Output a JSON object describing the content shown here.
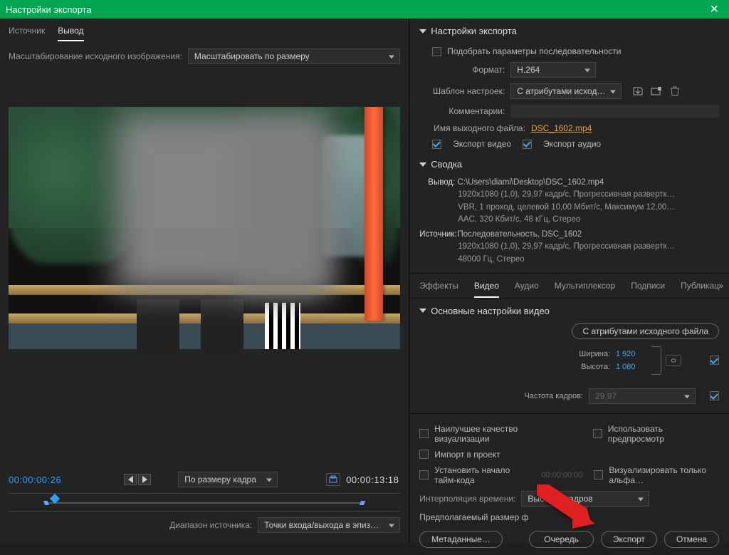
{
  "window": {
    "title": "Настройки экспорта",
    "close": "✕"
  },
  "left": {
    "tabs": {
      "source": "Источник",
      "output": "Вывод"
    },
    "scale_label": "Масштабирование исходного изображения:",
    "scale_value": "Масштабировать по размеру",
    "tc_in": "00:00:00:26",
    "tc_out": "00:00:13:18",
    "fit_label": "По размеру кадра",
    "range_label": "Диапазон источника:",
    "range_value": "Точки входа/выхода в эпиз…"
  },
  "export": {
    "header": "Настройки экспорта",
    "match_seq": "Подобрать параметры последовательности",
    "format_label": "Формат:",
    "format_value": "H.264",
    "preset_label": "Шаблон настроек:",
    "preset_value": "С атрибутами исход…",
    "comments_label": "Комментарии:",
    "outname_label": "Имя выходного файла:",
    "outname_value": "DSC_1602.mp4",
    "export_video": "Экспорт видео",
    "export_audio": "Экспорт аудио"
  },
  "summary": {
    "header": "Сводка",
    "out_label": "Вывод:",
    "out_line1": "C:\\Users\\diami\\Desktop\\DSC_1602.mp4",
    "out_line2": "1920x1080 (1,0), 29,97 кадр/с, Прогрессивная развертк…",
    "out_line3": "VBR, 1 проход, целевой 10,00 Мбит/с, Максимум 12,00…",
    "out_line4": "AAC, 320 Кбит/с, 48 кГц, Стерео",
    "src_label": "Источник:",
    "src_line1": "Последовательность, DSC_1602",
    "src_line2": "1920x1080 (1,0), 29,97 кадр/с, Прогрессивная развертк…",
    "src_line3": "48000 Гц, Стерео"
  },
  "rtabs": {
    "effects": "Эффекты",
    "video": "Видео",
    "audio": "Аудио",
    "mux": "Мультиплексор",
    "captions": "Подписи",
    "publish": "Публикац"
  },
  "video": {
    "header": "Основные настройки видео",
    "match_btn": "С атрибутами исходного файла",
    "width_label": "Ширина:",
    "width_value": "1 920",
    "height_label": "Высота:",
    "height_value": "1 080",
    "fps_label": "Частота кадров:",
    "fps_value": "29,97"
  },
  "bottom": {
    "max_quality": "Наилучшее качество визуализации",
    "use_preview": "Использовать предпросмотр",
    "import_project": "Импорт в проект",
    "set_timecode": "Установить начало тайм-кода",
    "timecode_ghost": "00:00:00:00",
    "render_alpha": "Визуализировать только альфа…",
    "interp_label": "Интерполяция времени:",
    "interp_value": "Выборка кадров",
    "est_size": "Предполагаемый размер ф",
    "metadata": "Метаданные…",
    "queue": "Очередь",
    "export": "Экспорт",
    "cancel": "Отмена"
  }
}
